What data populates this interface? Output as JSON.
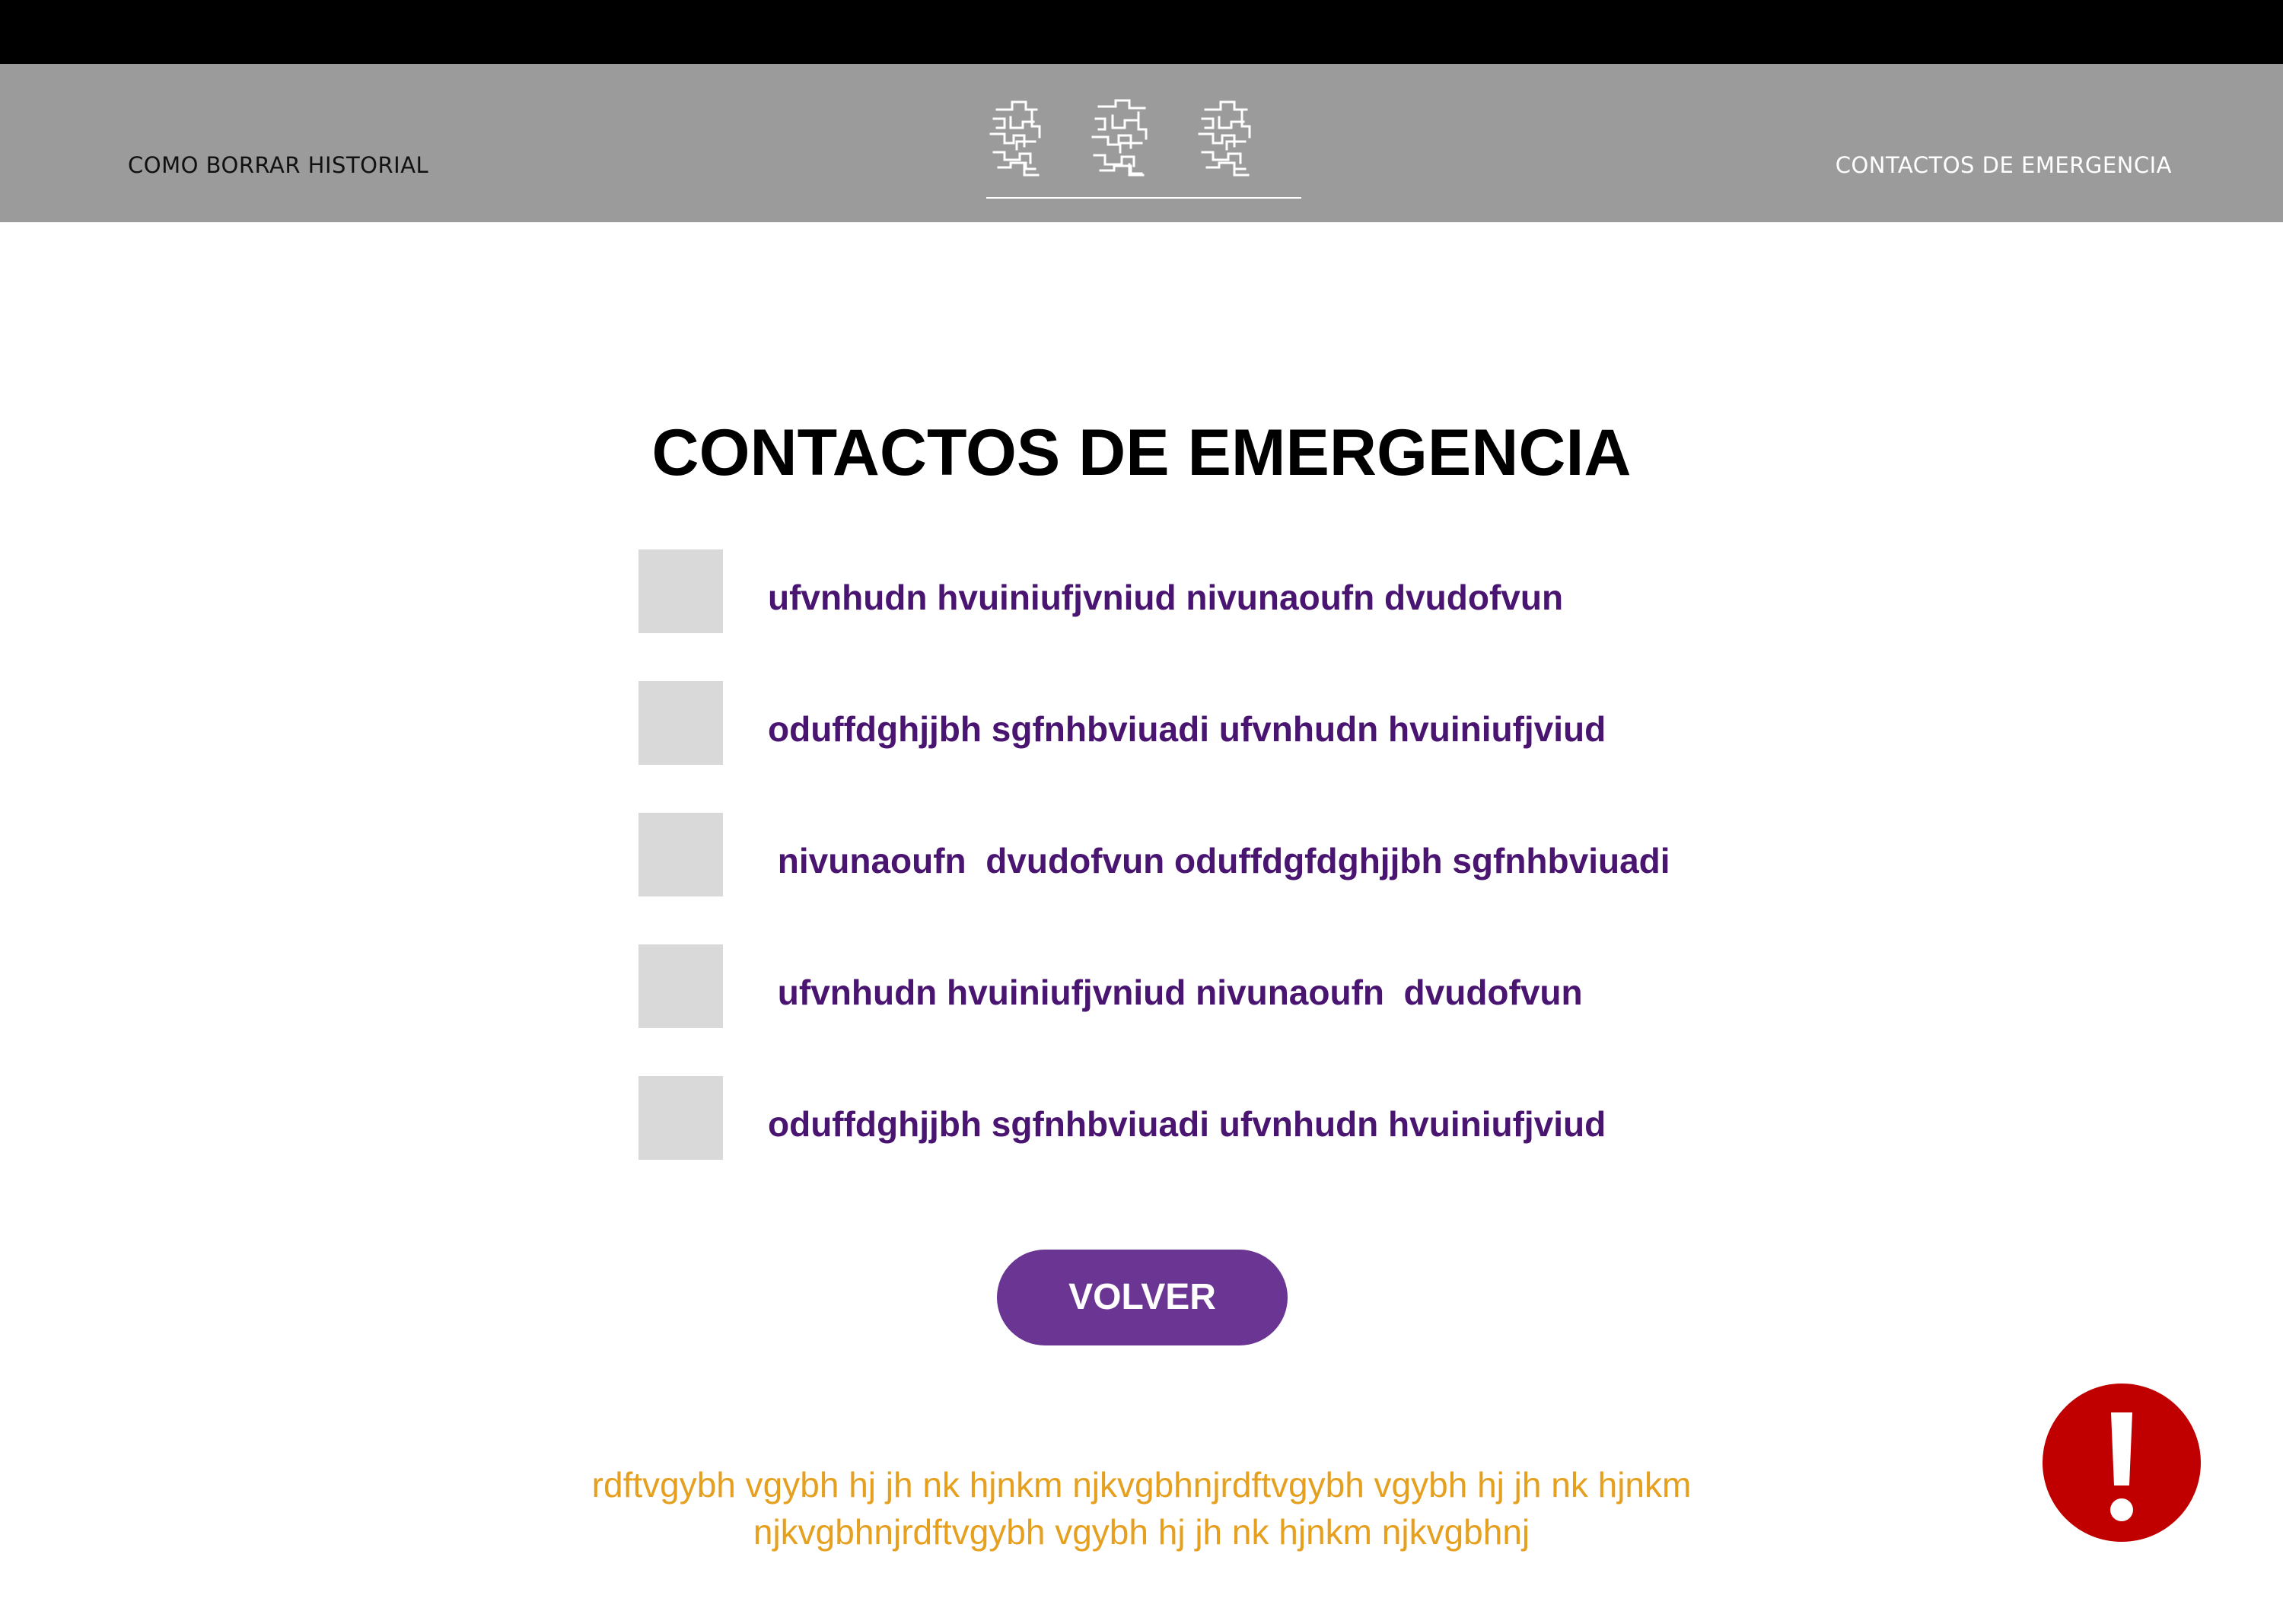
{
  "header": {
    "left_link": "COMO BORRAR HISTORIAL",
    "right_link": "CONTACTOS DE EMERGENCIA",
    "background": "#9b9b9b",
    "logo_icon": "maze-pattern-logo"
  },
  "main": {
    "title": "CONTACTOS DE EMERGENCIA",
    "contacts": [
      "ufvnhudn hvuiniufjvniud nivunaoufn  dvudofvun",
      "oduffdghjjbh sgfnhbviuadi ufvnhudn hvuiniufjviud",
      " nivunaoufn  dvudofvun oduffdgfdghjjbh sgfnhbviuadi",
      " ufvnhudn hvuiniufjvniud nivunaoufn  dvudofvun",
      "oduffdghjjbh sgfnhbviuadi ufvnhudn hvuiniufjviud"
    ],
    "button_label": "VOLVER"
  },
  "footer": {
    "line1": "rdftvgybh vgybh hj jh nk hjnkm njkvgbhnjrdftvgybh vgybh hj jh nk hjnkm",
    "line2": "njkvgbhnjrdftvgybh vgybh hj jh nk hjnkm njkvgbhnj"
  },
  "alert": {
    "icon": "exclamation-icon",
    "color": "#c00000"
  },
  "colors": {
    "accent": "#6b3594",
    "contact_text": "#4a1571",
    "footer_text": "#e6a020",
    "placeholder_box": "#d9d9d9"
  }
}
